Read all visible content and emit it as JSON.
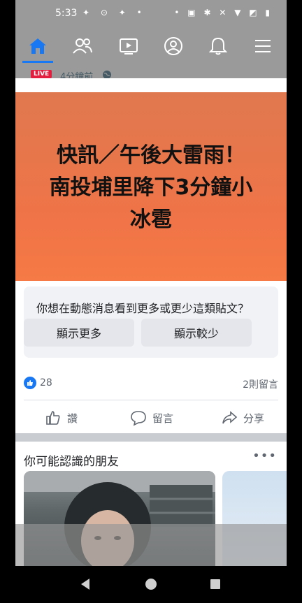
{
  "status_bar": {
    "time": "5:33",
    "left_icons": "✦ ⊙ ✦ •",
    "right_icons": "• ▣ ✱ ✕ ▼ ◩ ▮"
  },
  "nav": {
    "tabs": [
      "home",
      "friends",
      "watch",
      "profile",
      "notifications",
      "menu"
    ],
    "active": "home",
    "accent": "#1877f2"
  },
  "post": {
    "live_label": "LIVE",
    "time_ago": "4分鐘前",
    "headline_line1": "快訊／午後大雷雨！",
    "headline_line2": "南投埔里降下3分鐘小",
    "headline_line3": "冰雹",
    "hero_color": "#f07447",
    "feedback_question": "你想在動態消息看到更多或更少這類貼文？",
    "show_more": "顯示更多",
    "show_less": "顯示較少",
    "like_count": "28",
    "comment_count": "2則留言",
    "like_action": "讚",
    "comment_action": "留言",
    "share_action": "分享"
  },
  "pymk": {
    "title": "你可能認識的朋友",
    "more": "•••"
  }
}
